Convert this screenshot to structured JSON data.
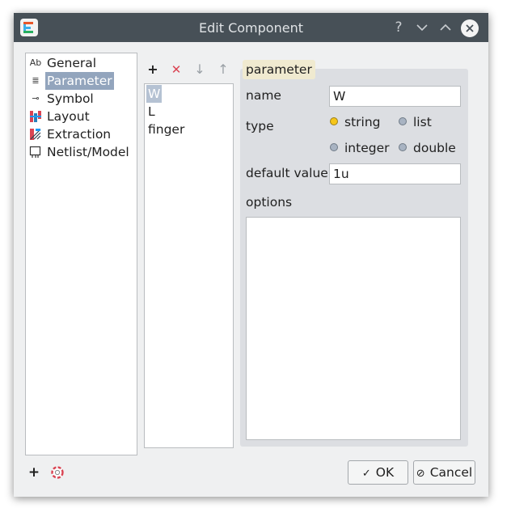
{
  "window": {
    "title": "Edit Component",
    "app_icon": "app-logo-icon",
    "title_buttons": [
      {
        "name": "help-icon",
        "glyph": "?"
      },
      {
        "name": "minimize-icon",
        "glyph": "⌄"
      },
      {
        "name": "maximize-icon",
        "glyph": "⌃"
      },
      {
        "name": "close-icon",
        "glyph": "✕"
      }
    ]
  },
  "sidebar": {
    "items": [
      {
        "label": "General",
        "icon": "Ab",
        "icon_name": "text-ab-icon",
        "selected": false
      },
      {
        "label": "Parameter",
        "icon": "≣",
        "icon_name": "list-lines-icon",
        "selected": true
      },
      {
        "label": "Symbol",
        "icon": "⊸",
        "icon_name": "symbol-icon",
        "selected": false
      },
      {
        "label": "Layout",
        "icon": "▦",
        "icon_name": "layout-icon",
        "selected": false
      },
      {
        "label": "Extraction",
        "icon": "⋇",
        "icon_name": "extraction-icon",
        "selected": false
      },
      {
        "label": "Netlist/Model",
        "icon": "◫",
        "icon_name": "netlist-icon",
        "selected": false
      }
    ]
  },
  "param_toolbar": {
    "add": "+",
    "remove": "✕",
    "down": "↓",
    "up": "↑"
  },
  "param_list": {
    "items": [
      {
        "label": "W",
        "selected": true
      },
      {
        "label": "L",
        "selected": false
      },
      {
        "label": "finger",
        "selected": false
      }
    ]
  },
  "parameter_group": {
    "title": "parameter",
    "name_label": "name",
    "name_value": "W",
    "type_label": "type",
    "type_options": [
      {
        "label": "string",
        "checked": true
      },
      {
        "label": "list",
        "checked": false
      },
      {
        "label": "integer",
        "checked": false
      },
      {
        "label": "double",
        "checked": false
      }
    ],
    "default_label": "default value",
    "default_value": "1u",
    "options_label": "options",
    "options_value": ""
  },
  "footer": {
    "add_icon": "+",
    "help_icon": "lifebuoy-icon",
    "ok_label": "OK",
    "ok_icon": "✓",
    "cancel_label": "Cancel",
    "cancel_icon": "⊘"
  },
  "colors": {
    "titlebar": "#475057",
    "selection": "#93a5bd",
    "group_bg": "#dcdee2",
    "radio_on": "#f5c518",
    "remove_red": "#da4453"
  }
}
